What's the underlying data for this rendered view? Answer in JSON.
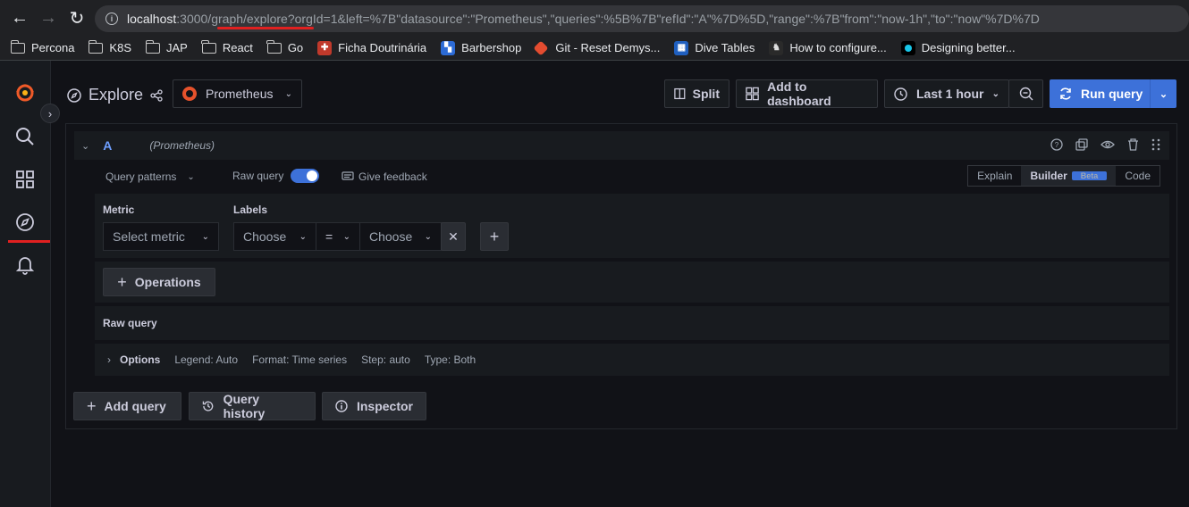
{
  "browser": {
    "url_host": "localhost",
    "url_path_a": ":3000/",
    "url_path_b": "graph/explore",
    "url_query": "?orgId=1&left=%7B\"datasource\":\"Prometheus\",\"queries\":%5B%7B\"refId\":\"A\"%7D%5D,\"range\":%7B\"from\":\"now-1h\",\"to\":\"now\"%7D%7D",
    "bookmarks": [
      {
        "label": "Percona",
        "icon": "folder-icon"
      },
      {
        "label": "K8S",
        "icon": "folder-icon"
      },
      {
        "label": "JAP",
        "icon": "folder-icon"
      },
      {
        "label": "React",
        "icon": "folder-icon"
      },
      {
        "label": "Go",
        "icon": "folder-icon"
      },
      {
        "label": "Ficha Doutrinária",
        "icon": "ficha-favicon"
      },
      {
        "label": "Barbershop",
        "icon": "barbershop-favicon"
      },
      {
        "label": "Git - Reset Demys...",
        "icon": "git-favicon"
      },
      {
        "label": "Dive Tables",
        "icon": "dive-favicon"
      },
      {
        "label": "How to configure...",
        "icon": "page-favicon"
      },
      {
        "label": "Designing better...",
        "icon": "design-favicon"
      }
    ]
  },
  "header": {
    "title": "Explore",
    "datasource": "Prometheus",
    "split_label": "Split",
    "add_dashboard_label": "Add to dashboard",
    "time_range": "Last 1 hour",
    "run_query_label": "Run query"
  },
  "query": {
    "ref_id": "A",
    "datasource_hint": "(Prometheus)",
    "query_patterns": "Query patterns",
    "raw_query_toggle": "Raw query",
    "give_feedback": "Give feedback",
    "modes": {
      "explain": "Explain",
      "builder": "Builder",
      "beta": "Beta",
      "code": "Code"
    },
    "metric_label": "Metric",
    "metric_placeholder": "Select metric",
    "labels_label": "Labels",
    "label_key_placeholder": "Choose",
    "label_op": "=",
    "label_value_placeholder": "Choose",
    "operations_label": "Operations",
    "raw_query_label": "Raw query",
    "options": {
      "title": "Options",
      "legend": "Legend: Auto",
      "format": "Format: Time series",
      "step": "Step: auto",
      "type": "Type: Both"
    }
  },
  "footer_buttons": {
    "add_query": "Add query",
    "query_history": "Query history",
    "inspector": "Inspector"
  },
  "colors": {
    "accent": "#3d71d9",
    "annotation_red": "#e02020",
    "grafana_orange": "#f05a28"
  }
}
